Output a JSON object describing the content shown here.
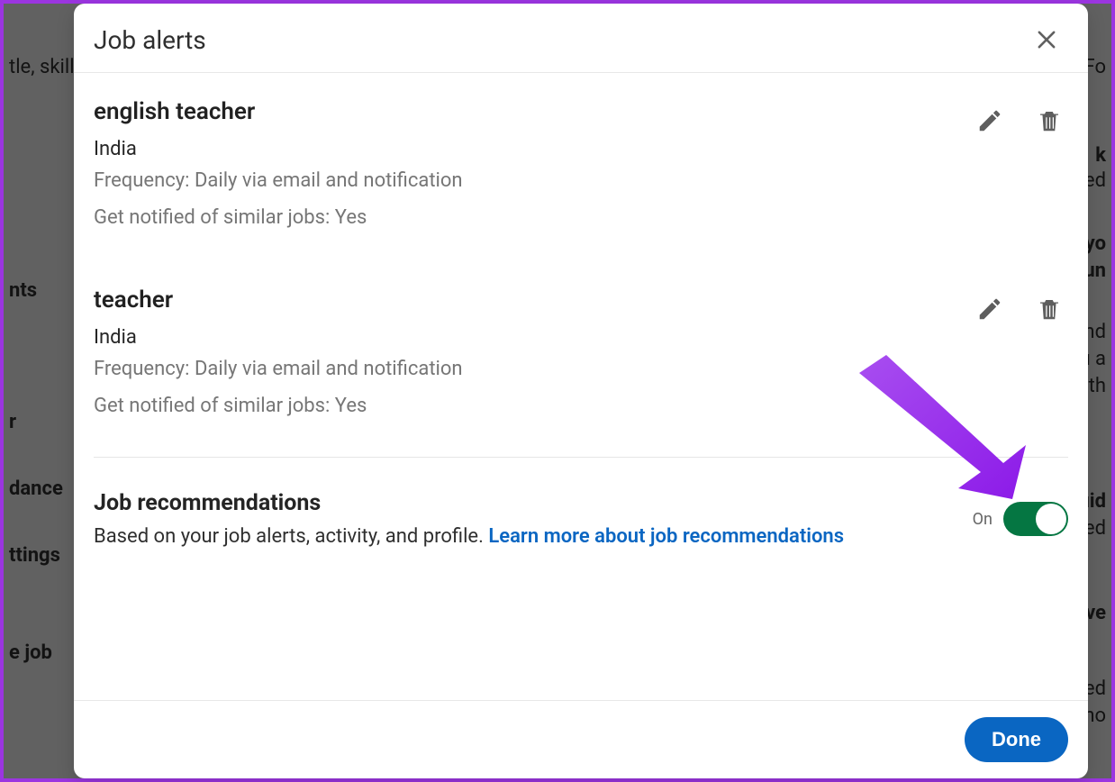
{
  "background": {
    "search_placeholder": "tle, skill,",
    "right_text": "Fo",
    "left_items": [
      "nts",
      "r",
      "dance",
      "ttings",
      "e job"
    ],
    "right_items": [
      "k",
      "ased",
      "s yo",
      "tun",
      "nand",
      "ou a",
      "es th",
      "uid",
      "ased",
      "ove",
      "ated",
      "s ho"
    ]
  },
  "modal": {
    "title": "Job alerts",
    "done_label": "Done"
  },
  "alerts": [
    {
      "title": "english teacher",
      "location": "India",
      "frequency": "Frequency: Daily via email and notification",
      "similar": "Get notified of similar jobs: Yes"
    },
    {
      "title": "teacher",
      "location": "India",
      "frequency": "Frequency: Daily via email and notification",
      "similar": "Get notified of similar jobs: Yes"
    }
  ],
  "recommendations": {
    "title": "Job recommendations",
    "description": "Based on your job alerts, activity, and profile. ",
    "link_text": "Learn more about job recommendations",
    "toggle_state": "On"
  }
}
